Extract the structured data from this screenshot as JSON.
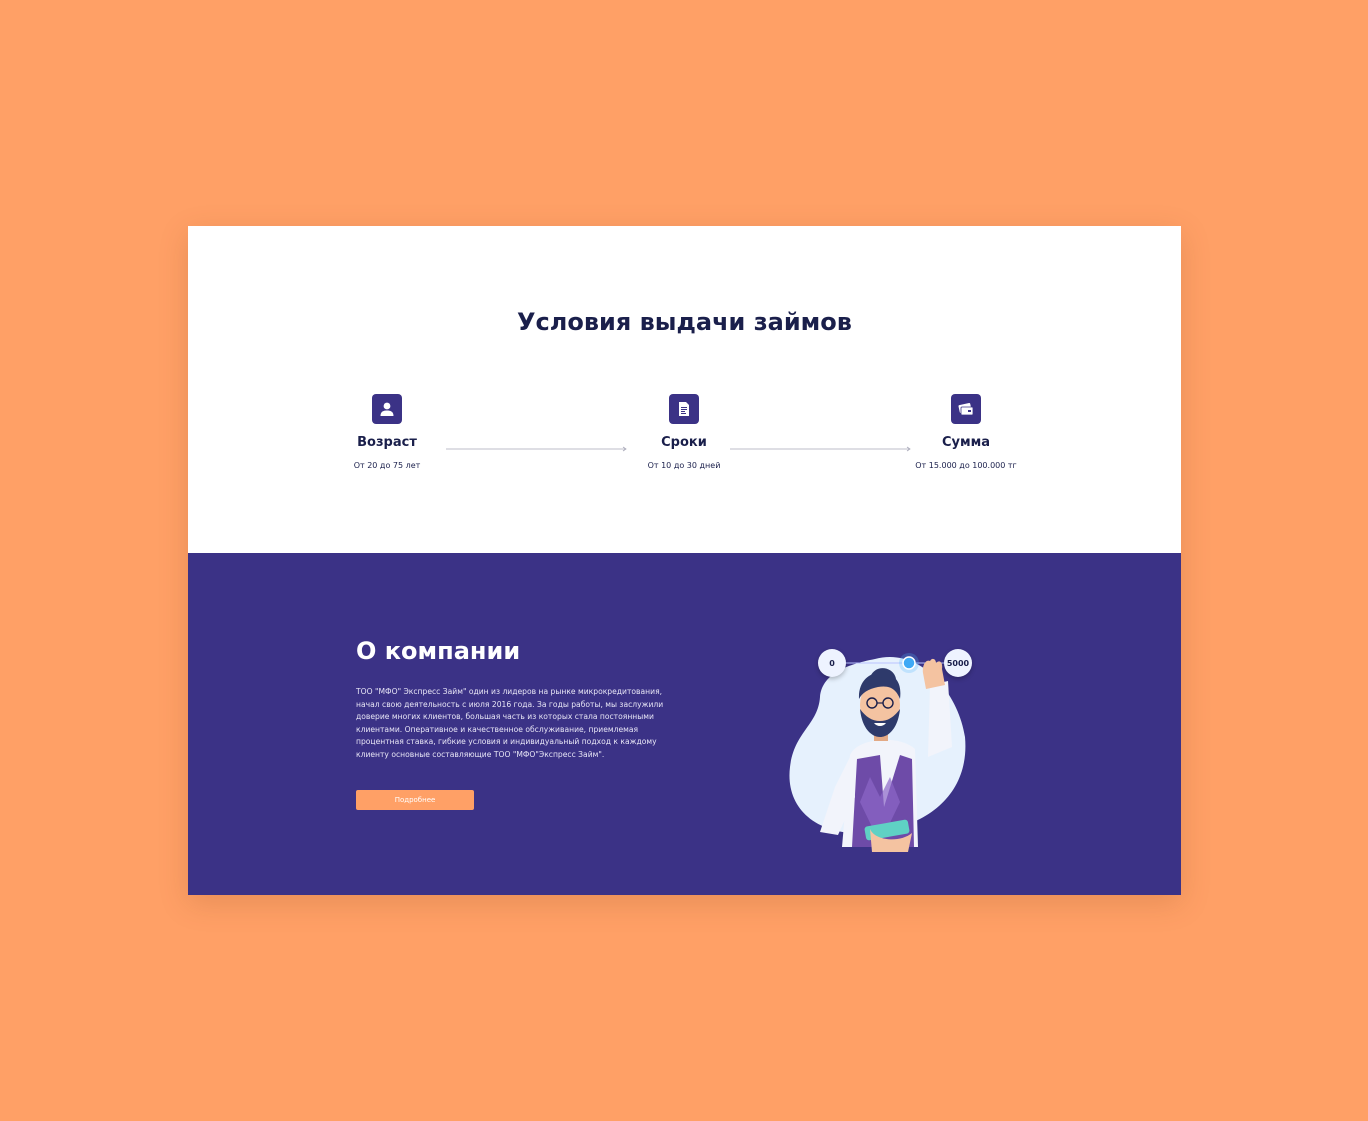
{
  "conditions": {
    "title": "Условия выдачи займов",
    "items": [
      {
        "label": "Возраст",
        "value": "От 20 до 75 лет",
        "icon": "person-icon"
      },
      {
        "label": "Сроки",
        "value": "От 10 до 30 дней",
        "icon": "document-icon"
      },
      {
        "label": "Сумма",
        "value": "От 15.000 до 100.000 тг",
        "icon": "card-icon"
      }
    ]
  },
  "about": {
    "title": "О компании",
    "text": "ТОО \"МФО\" Экспресс Займ\" один из лидеров на рынке микрокредитования, начал свою деятельность с июля 2016 года. За годы работы, мы заслужили доверие многих клиентов, большая часть из которых стала постоянными клиентами. Оперативное и качественное обслуживание, приемлемая процентная ставка, гибкие условия и индивидуальный подход к каждому клиенту  основные составляющие ТОО \"МФО\"Экспресс Займ\".",
    "button_label": "Подробнее",
    "slider": {
      "min_label": "0",
      "max_label": "5000"
    }
  },
  "colors": {
    "background": "#FFA066",
    "primary": "#3B3286",
    "accent": "#FFA066",
    "heading": "#1A1F4B"
  }
}
